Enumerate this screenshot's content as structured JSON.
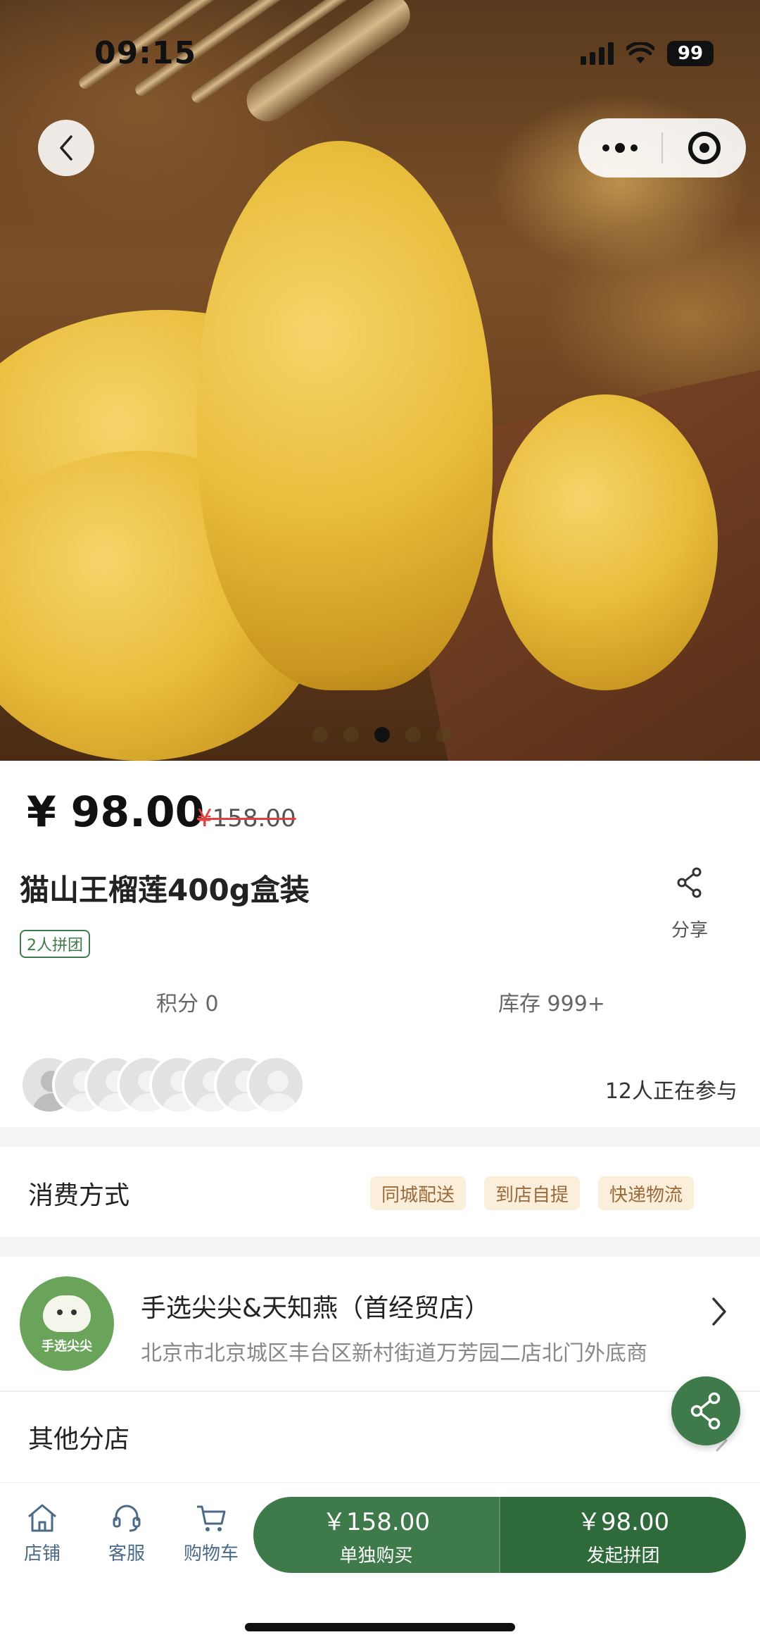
{
  "status_bar": {
    "time": "09:15",
    "battery": "99"
  },
  "carousel": {
    "count": 5,
    "active_index": 2
  },
  "product": {
    "price": "¥ 98.00",
    "original_price_symbol": "¥",
    "original_price_value": "158.00",
    "title": "猫山王榴莲400g盒装",
    "group_tag": "2人拼团",
    "share_label": "分享",
    "points": "积分 0",
    "stock": "库存 999+",
    "participants": "12人正在参与"
  },
  "consumption": {
    "title": "消费方式",
    "methods": [
      "同城配送",
      "到店自提",
      "快递物流"
    ]
  },
  "store": {
    "logo_text": "手选尖尖",
    "name": "手选尖尖&天知燕（首经贸店）",
    "address": "北京市北京城区丰台区新村街道万芳园二店北门外底商",
    "other_branches": "其他分店"
  },
  "bottom_bar": {
    "tabs": [
      {
        "label": "店铺",
        "icon": "home-icon"
      },
      {
        "label": "客服",
        "icon": "headset-icon"
      },
      {
        "label": "购物车",
        "icon": "cart-icon"
      }
    ],
    "buy_single": {
      "price": "￥158.00",
      "label": "单独购买"
    },
    "buy_group": {
      "price": "￥98.00",
      "label": "发起拼团"
    }
  },
  "colors": {
    "brand_green": "#3f7a4a",
    "chip_bg": "#fbeedb",
    "chip_text": "#9a6a3a",
    "strike_red": "#e04040"
  }
}
